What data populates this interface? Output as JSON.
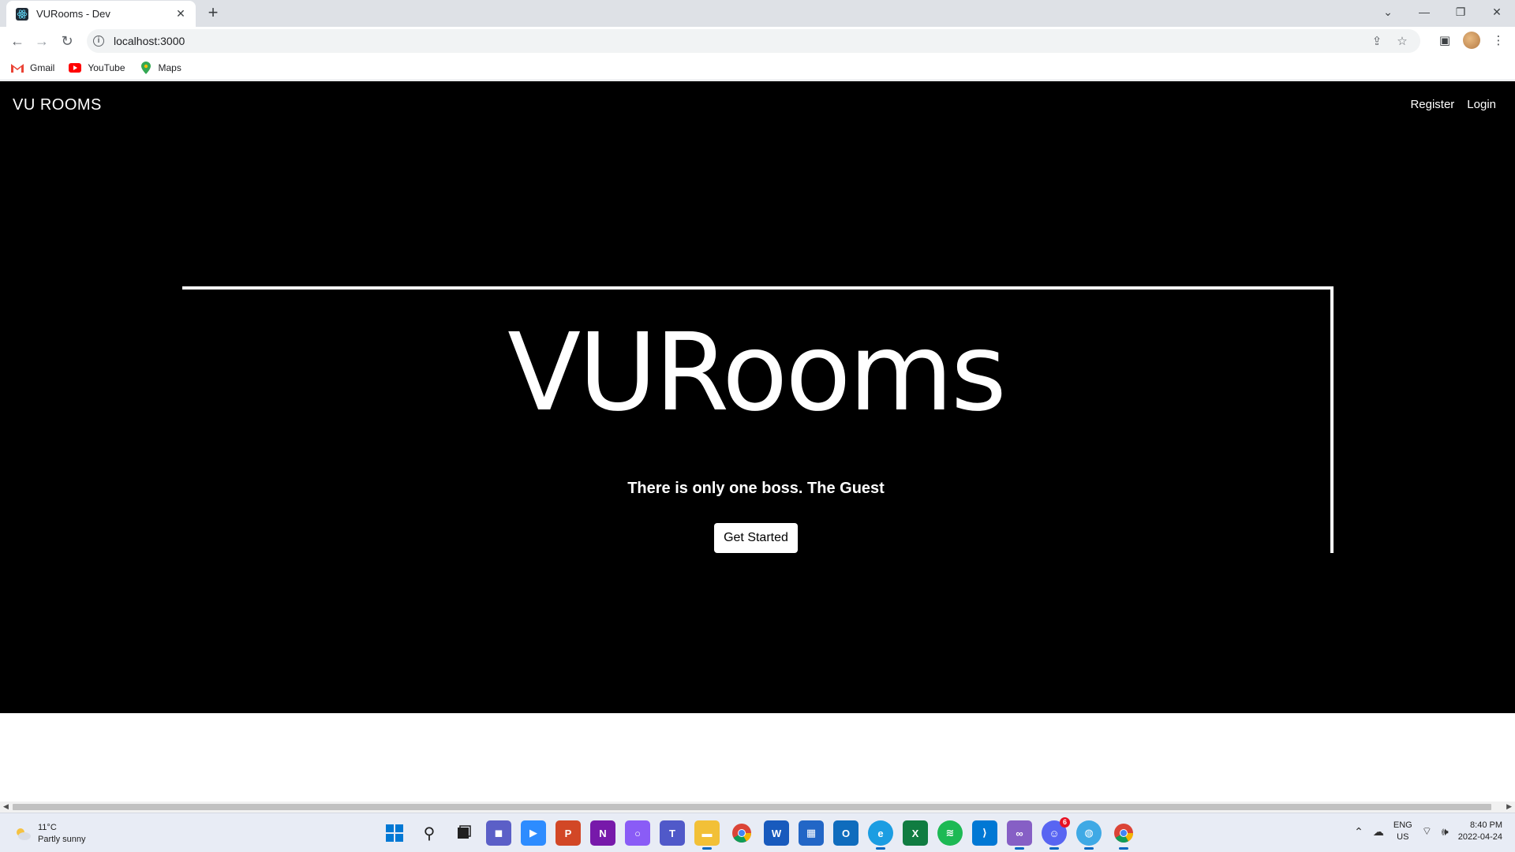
{
  "browser": {
    "tab_title": "VURooms - Dev",
    "url": "localhost:3000",
    "bookmarks": [
      {
        "label": "Gmail",
        "icon": "gmail-icon"
      },
      {
        "label": "YouTube",
        "icon": "youtube-icon"
      },
      {
        "label": "Maps",
        "icon": "maps-icon"
      }
    ]
  },
  "site": {
    "brand": "VU ROOMS",
    "nav": {
      "register": "Register",
      "login": "Login"
    },
    "hero": {
      "title": "VURooms",
      "tagline": "There is only one boss. The Guest",
      "cta": "Get Started"
    }
  },
  "taskbar": {
    "weather": {
      "temp": "11°C",
      "desc": "Partly sunny"
    },
    "lang": {
      "line1": "ENG",
      "line2": "US"
    },
    "clock": {
      "time": "8:40 PM",
      "date": "2022-04-24"
    },
    "discord_badge": "6"
  },
  "colors": {
    "page_bg": "#000000",
    "text": "#ffffff",
    "button_bg": "#ffffff"
  }
}
